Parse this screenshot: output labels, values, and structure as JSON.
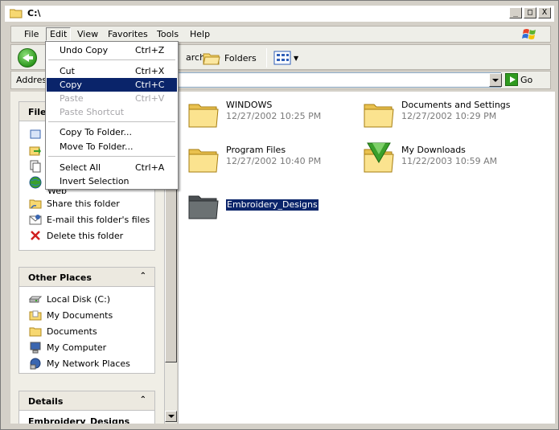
{
  "window": {
    "title": "C:\\",
    "buttons": {
      "minimize": "_",
      "maximize": "□",
      "close": "X"
    }
  },
  "menubar": {
    "items": [
      "File",
      "Edit",
      "View",
      "Favorites",
      "Tools",
      "Help"
    ]
  },
  "toolbar": {
    "back_label_fragment": "B",
    "search_label": "arch",
    "folders_label": "Folders"
  },
  "address": {
    "label": "Address",
    "go_label": "Go"
  },
  "edit_menu": {
    "undo": {
      "label": "Undo Copy",
      "shortcut": "Ctrl+Z"
    },
    "cut": {
      "label": "Cut",
      "shortcut": "Ctrl+X"
    },
    "copy": {
      "label": "Copy",
      "shortcut": "Ctrl+C"
    },
    "paste": {
      "label": "Paste",
      "shortcut": "Ctrl+V"
    },
    "paste_shortcut": {
      "label": "Paste Shortcut"
    },
    "copy_to_folder": {
      "label": "Copy To Folder..."
    },
    "move_to_folder": {
      "label": "Move To Folder..."
    },
    "select_all": {
      "label": "Select All",
      "shortcut": "Ctrl+A"
    },
    "invert_selection": {
      "label": "Invert Selection"
    }
  },
  "taskpane": {
    "file_tasks": {
      "title": "File",
      "web_fragment": "Web",
      "items": [
        "Share this folder",
        "E-mail this folder's files",
        "Delete this folder"
      ]
    },
    "other_places": {
      "title": "Other Places",
      "items": [
        "Local Disk (C:)",
        "My Documents",
        "Documents",
        "My Computer",
        "My Network Places"
      ]
    },
    "details": {
      "title": "Details",
      "name_fragment": "Embroidery_Designs"
    }
  },
  "files": [
    {
      "name": "WINDOWS",
      "date": "12/27/2002 10:25 PM"
    },
    {
      "name": "Documents and Settings",
      "date": "12/27/2002 10:29 PM"
    },
    {
      "name": "Program Files",
      "date": "12/27/2002 10:40 PM"
    },
    {
      "name": "My Downloads",
      "date": "11/22/2003 10:59 AM"
    },
    {
      "name": "Embroidery_Designs",
      "date": ""
    }
  ],
  "colors": {
    "selection": "#0a246a",
    "folder_yellow": "#f7d871",
    "window_face": "#d4d0c8"
  }
}
